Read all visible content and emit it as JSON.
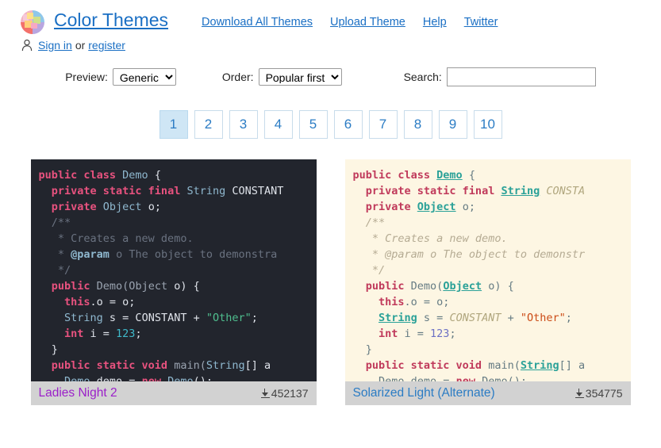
{
  "header": {
    "site_title": "Color Themes",
    "logo_icon": "color-wheel-icon",
    "nav": [
      {
        "label": "Download All Themes"
      },
      {
        "label": "Upload Theme"
      },
      {
        "label": "Help"
      },
      {
        "label": "Twitter"
      }
    ],
    "account": {
      "user_icon": "user-icon",
      "sign_in": "Sign in",
      "separator": "or",
      "register": "register"
    }
  },
  "controls": {
    "preview_label": "Preview:",
    "preview_value": "Generic",
    "preview_options": [
      "Generic"
    ],
    "order_label": "Order:",
    "order_value": "Popular first",
    "order_options": [
      "Popular first"
    ],
    "search_label": "Search:",
    "search_value": "",
    "search_placeholder": ""
  },
  "pagination": {
    "pages": [
      "1",
      "2",
      "3",
      "4",
      "5",
      "6",
      "7",
      "8",
      "9",
      "10"
    ],
    "active": "1"
  },
  "themes": [
    {
      "name": "Ladies Night 2",
      "downloads": "452137",
      "download_icon": "download-icon",
      "link_state": "visited",
      "background": "#22252d",
      "colors": {
        "keyword": "#e8527f",
        "type": "#8fb8cf",
        "plain": "#dfe3ea",
        "comment": "#6a7280",
        "string": "#4fbf8f",
        "number": "#3fb9c9"
      }
    },
    {
      "name": "Solarized Light (Alternate)",
      "downloads": "354775",
      "download_icon": "download-icon",
      "link_state": "unvisited",
      "background": "#fdf6e3",
      "colors": {
        "keyword": "#c03a5b",
        "type": "#2aa198",
        "plain": "#657b83",
        "comment": "#b5ab93",
        "string": "#cb4b16",
        "number": "#6c71c4"
      }
    }
  ],
  "code_sample": {
    "lines": [
      "public class Demo {",
      "  private static final String CONSTANT",
      "  private Object o;",
      "  /**",
      "   * Creates a new demo.",
      "   * @param o The object to demonstra",
      "   */",
      "  public Demo(Object o) {",
      "    this.o = o;",
      "    String s = CONSTANT + \"Other\";",
      "    int i = 123;",
      "  }",
      "  public static void main(String[] a",
      "    Demo demo = new Demo();"
    ]
  }
}
